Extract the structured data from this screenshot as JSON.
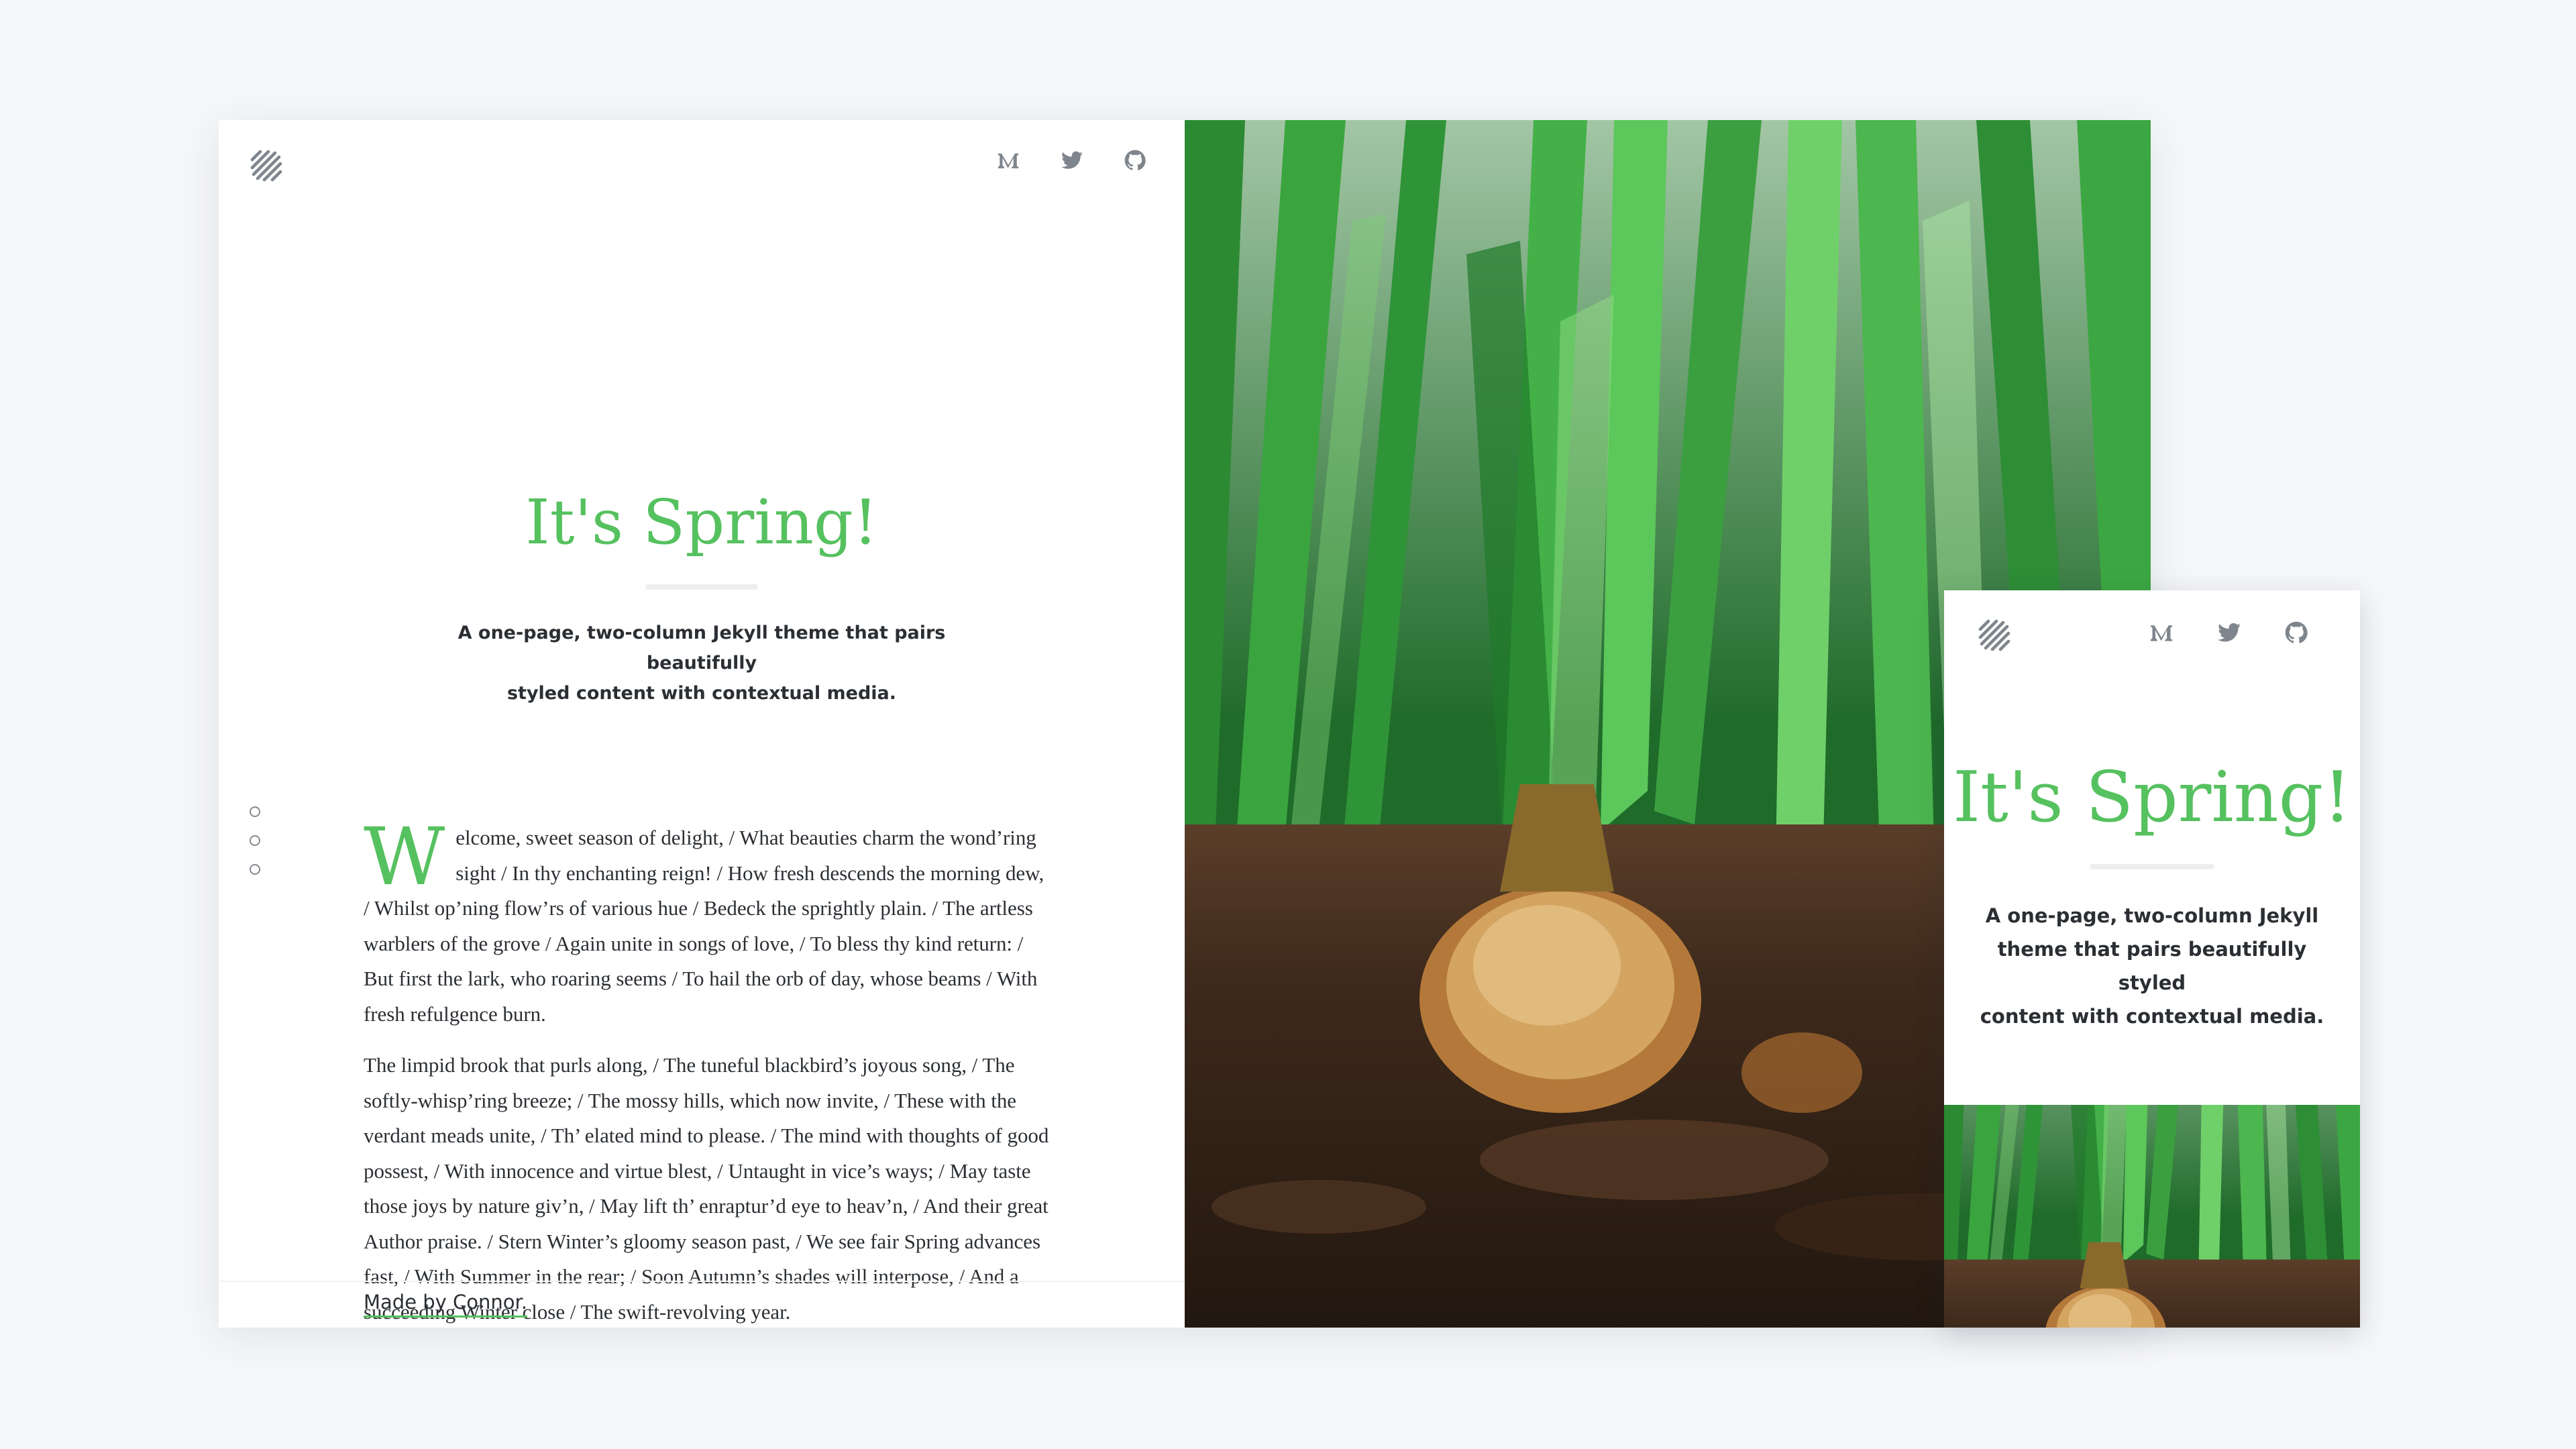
{
  "desktop": {
    "social": {
      "medium_icon": "medium-icon",
      "twitter_icon": "twitter-icon",
      "github_icon": "github-icon"
    },
    "hero": {
      "title": "It's Spring!",
      "tagline_line1": "A one-page, two-column Jekyll theme that pairs beautifully",
      "tagline_line2": "styled content with contextual media."
    },
    "content": {
      "dropcap": "W",
      "paragraph1": "elcome, sweet season of delight, / What beauties charm the wond’ring sight / In thy enchanting reign! / How fresh descends the morning dew, / Whilst op’ning flow’rs of various hue / Bedeck the sprightly plain. / The artless warblers of the grove / Again unite in songs of love, / To bless thy kind return: / But first the lark, who roaring seems / To hail the orb of day, whose beams / With fresh refulgence burn.",
      "paragraph2": "The limpid brook that purls along, / The tuneful blackbird’s joyous song, / The softly-whisp’ring breeze; / The mossy hills, which now invite, / These with the verdant meads unite, / Th’ elated mind to please. / The mind with thoughts of good possest, / With innocence and virtue blest, / Untaught in vice’s ways; / May taste those joys by nature giv’n, / May lift th’ enraptur’d eye to heav’n, / And their great Author praise. / Stern Winter’s gloomy season past, / We see fair Spring advances fast, / With Summer in the rear; / Soon Autumn’s shades will interpose, / And a succeeding Winter close / The swift-revolving year."
    },
    "footer": "Made by Connor."
  },
  "mobile": {
    "title": "It's Spring!",
    "tagline_line1": "A one-page, two-column Jekyll",
    "tagline_line2": "theme that pairs beautifully styled",
    "tagline_line3": "content with contextual media."
  },
  "colors": {
    "accent": "#56c15f",
    "text": "#2b2f33",
    "icon": "#7f858c",
    "background": "#f6f7f9"
  }
}
